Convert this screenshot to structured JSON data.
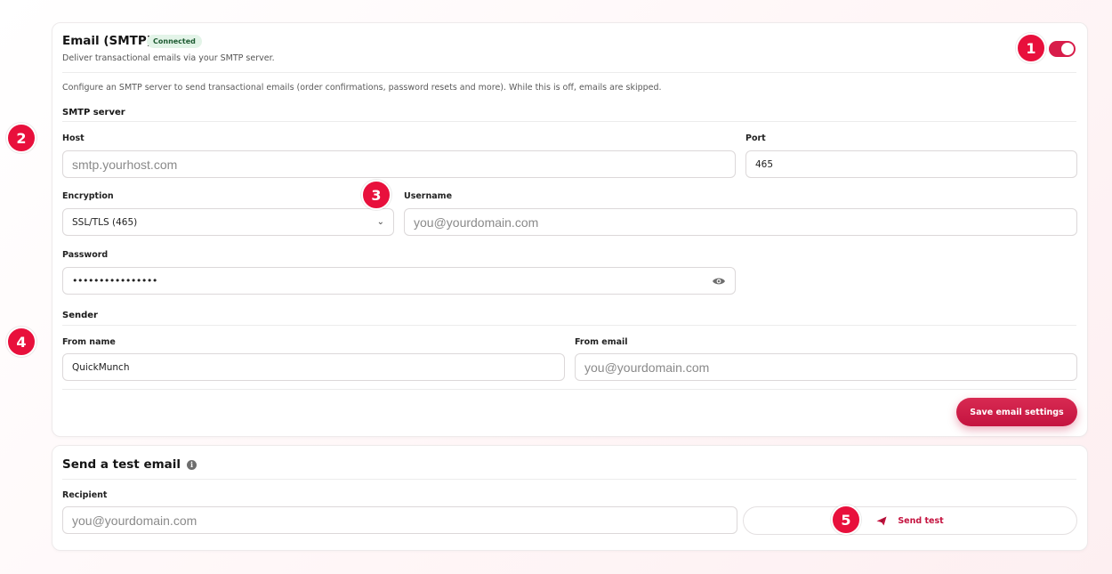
{
  "smtp": {
    "title": "Email (SMTP)",
    "status_badge": "Connected",
    "subtitle": "Deliver transactional emails via your SMTP server.",
    "enabled": true,
    "description": "Configure an SMTP server to send transactional emails (order confirmations, password resets and more). While this is off, emails are skipped.",
    "server_section": "SMTP server",
    "host_label": "Host",
    "host_placeholder": "smtp.yourhost.com",
    "port_label": "Port",
    "port_value": "465",
    "encryption_label": "Encryption",
    "encryption_value": "SSL/TLS (465)",
    "username_label": "Username",
    "username_placeholder": "you@yourdomain.com",
    "password_label": "Password",
    "password_value": "••••••••••••••••",
    "sender_section": "Sender",
    "from_name_label": "From name",
    "from_name_value": "QuickMunch",
    "from_email_label": "From email",
    "from_email_placeholder": "you@yourdomain.com",
    "save_label": "Save email settings"
  },
  "test": {
    "title": "Send a test email",
    "recipient_label": "Recipient",
    "recipient_placeholder": "you@yourdomain.com",
    "send_label": "Send test"
  },
  "markers": [
    "1",
    "2",
    "3",
    "4",
    "5"
  ],
  "colors": {
    "accent": "#d81d4a",
    "marker": "#e8103c",
    "badge_bg": "#e3f4e8",
    "badge_text": "#1d5a31"
  },
  "icons": {
    "password_toggle": "eye-icon",
    "send": "paper-plane-icon",
    "info": "info-icon",
    "encryption_dropdown": "chevron-down-icon"
  }
}
